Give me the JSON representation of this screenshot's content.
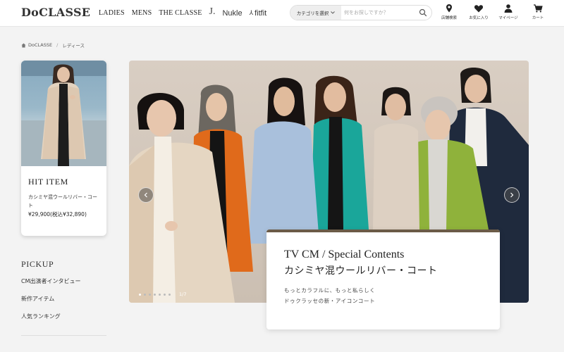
{
  "header": {
    "logo": "DoCLASSE",
    "nav": [
      "LADIES",
      "MENS",
      "THE CLASSE"
    ],
    "brands": {
      "j": "J.",
      "nukle": "Nukle",
      "fitfit": "fitfit"
    },
    "search": {
      "category": "カテゴリを選択",
      "placeholder": "何をお探しですか？"
    },
    "icons": [
      {
        "label": "店舗検索",
        "icon": "store-search-icon"
      },
      {
        "label": "お気に入り",
        "icon": "heart-icon"
      },
      {
        "label": "マイページ",
        "icon": "person-icon"
      },
      {
        "label": "カート",
        "icon": "cart-icon"
      }
    ]
  },
  "breadcrumb": {
    "home": "DoCLASSE",
    "current": "レディース"
  },
  "hit_item": {
    "title": "HIT ITEM",
    "name": "カシミヤ混ウールリバー・コート",
    "price": "¥29,900(税込¥32,890)"
  },
  "pickup": {
    "title": "PICKUP",
    "items": [
      "CM出演者インタビュー",
      "新作アイテム",
      "人気ランキング"
    ]
  },
  "hero": {
    "counter": "1/7",
    "slides": 7,
    "active_slide": 1,
    "caption": {
      "line1": "TV CM / Special Contents",
      "line2": "カシミヤ混ウールリバー・コート",
      "desc1": "もっとカラフルに、もっと私らしく",
      "desc2": "ドゥクラッセの新・アイコンコート"
    }
  },
  "colors": {
    "accent_bar": "#6b5b47",
    "background": "#f3f3f3"
  }
}
